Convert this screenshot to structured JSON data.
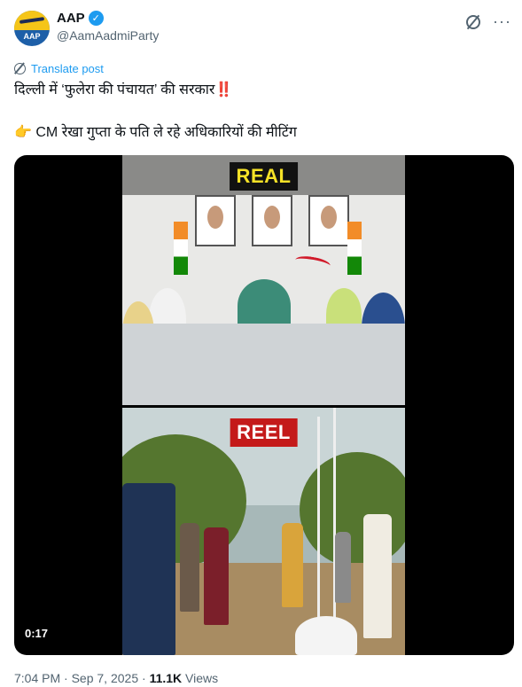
{
  "author": {
    "display_name": "AAP",
    "handle": "@AamAadmiParty",
    "verified": true,
    "avatar_text": "AAP",
    "avatar_colors": {
      "top": "#f5c518",
      "bottom": "#1d5fa8"
    }
  },
  "header_icons": {
    "grok": "grok-icon",
    "more": "more-icon"
  },
  "translate_label": "Translate post",
  "post": {
    "line1": "दिल्ली में ‘फुलेरा की पंचायत’ की सरकार",
    "line1_emoji": "‼️",
    "line2_emoji": "👉",
    "line2": "CM रेखा गुप्ता के पति ले रहे अधिकारियों की मीटिंग"
  },
  "media": {
    "label_top": "REAL",
    "label_bottom": "REEL",
    "duration": "0:17",
    "colors": {
      "real_label_bg": "#111111",
      "real_label_fg": "#f6e227",
      "reel_label_bg": "#c41a1a"
    }
  },
  "meta": {
    "time": "7:04 PM",
    "separator": "·",
    "date": "Sep 7, 2025",
    "views_count": "11.1K",
    "views_label": "Views"
  },
  "colors": {
    "link": "#1d9bf0",
    "muted": "#536471",
    "text": "#0f1419"
  }
}
